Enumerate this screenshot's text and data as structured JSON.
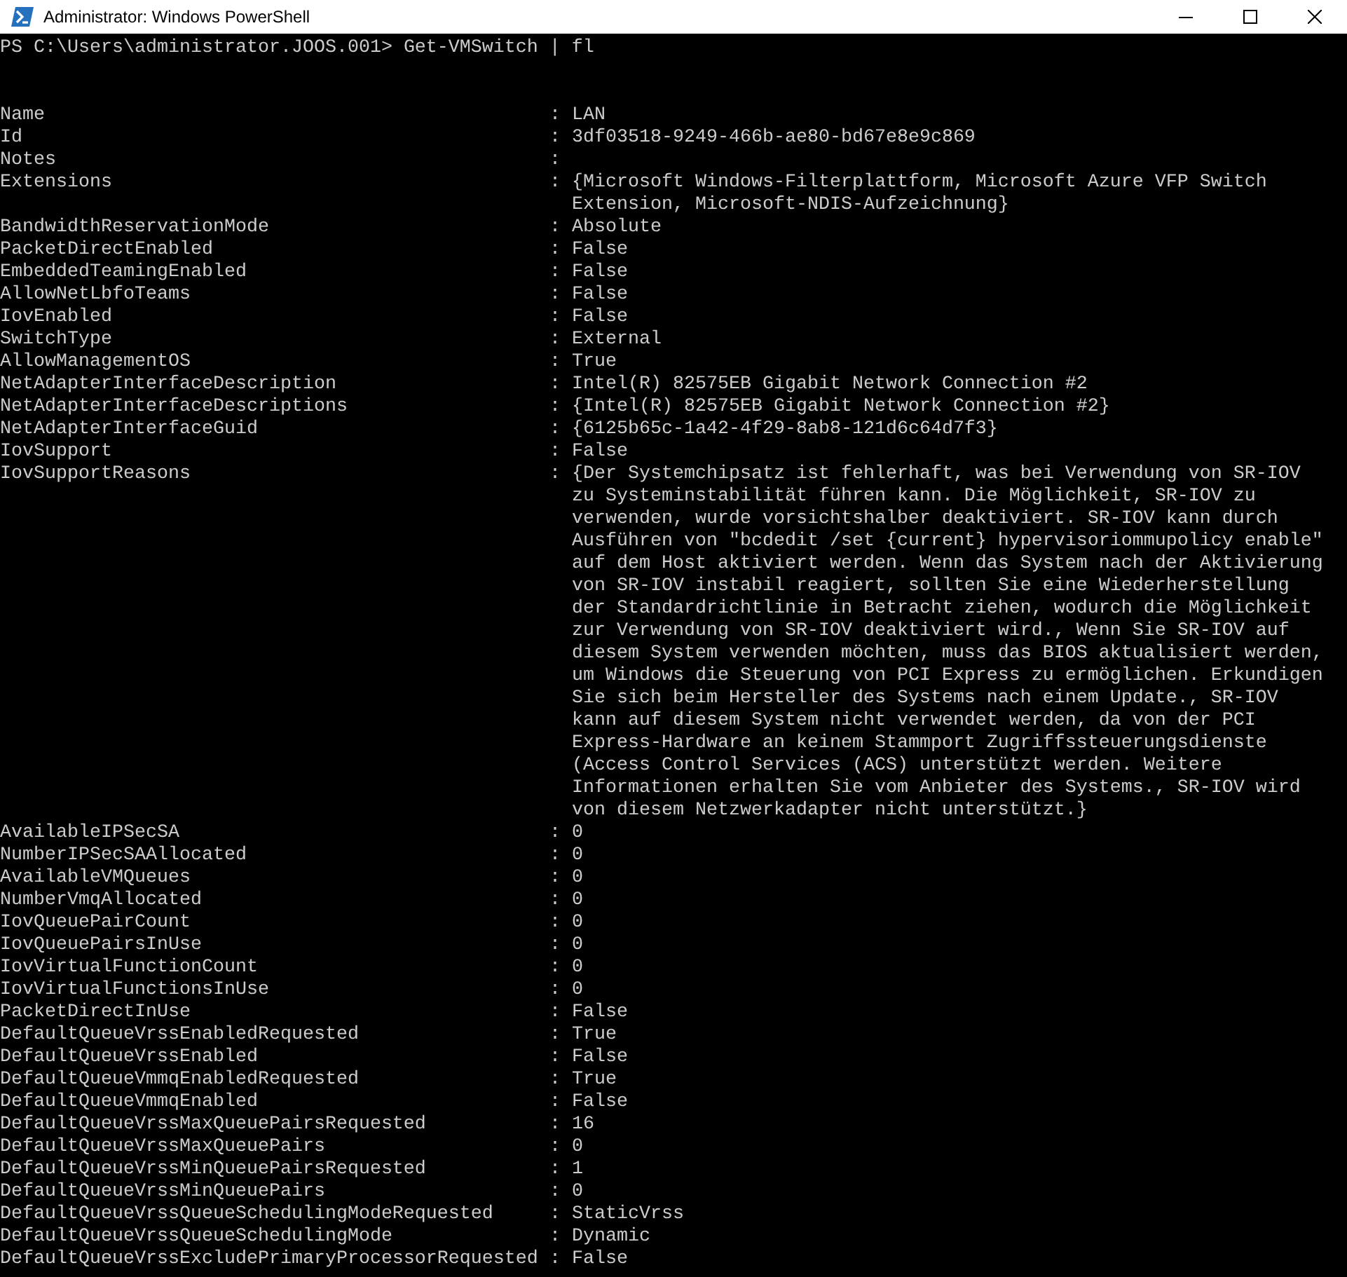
{
  "window": {
    "title": "Administrator: Windows PowerShell"
  },
  "console": {
    "prompt": "PS C:\\Users\\administrator.JOOS.001>",
    "command": "Get-VMSwitch | fl",
    "properties": [
      {
        "name": "Name",
        "sep": ":",
        "value": [
          "LAN"
        ]
      },
      {
        "name": "Id",
        "sep": ":",
        "value": [
          "3df03518-9249-466b-ae80-bd67e8e9c869"
        ]
      },
      {
        "name": "Notes",
        "sep": ":"
      },
      {
        "name": "Extensions",
        "sep": ":",
        "value": [
          "{Microsoft Windows-Filterplattform, Microsoft Azure VFP Switch",
          "Extension, Microsoft-NDIS-Aufzeichnung}"
        ]
      },
      {
        "name": "BandwidthReservationMode",
        "sep": ":",
        "value": [
          "Absolute"
        ]
      },
      {
        "name": "PacketDirectEnabled",
        "sep": ":",
        "value": [
          "False"
        ]
      },
      {
        "name": "EmbeddedTeamingEnabled",
        "sep": ":",
        "value": [
          "False"
        ]
      },
      {
        "name": "AllowNetLbfoTeams",
        "sep": ":",
        "value": [
          "False"
        ]
      },
      {
        "name": "IovEnabled",
        "sep": ":",
        "value": [
          "False"
        ]
      },
      {
        "name": "SwitchType",
        "sep": ":",
        "value": [
          "External"
        ]
      },
      {
        "name": "AllowManagementOS",
        "sep": ":",
        "value": [
          "True"
        ]
      },
      {
        "name": "NetAdapterInterfaceDescription",
        "sep": ":",
        "value": [
          "Intel(R) 82575EB Gigabit Network Connection #2"
        ]
      },
      {
        "name": "NetAdapterInterfaceDescriptions",
        "sep": ":",
        "value": [
          "{Intel(R) 82575EB Gigabit Network Connection #2}"
        ]
      },
      {
        "name": "NetAdapterInterfaceGuid",
        "sep": ":",
        "value": [
          "{6125b65c-1a42-4f29-8ab8-121d6c64d7f3}"
        ]
      },
      {
        "name": "IovSupport",
        "sep": ":",
        "value": [
          "False"
        ]
      },
      {
        "name": "IovSupportReasons",
        "sep": ":",
        "value": [
          "{Der Systemchipsatz ist fehlerhaft, was bei Verwendung von SR-IOV",
          "zu Systeminstabilität führen kann. Die Möglichkeit, SR-IOV zu",
          "verwenden, wurde vorsichtshalber deaktiviert. SR-IOV kann durch",
          "Ausführen von \"bcdedit /set {current} hypervisoriommupolicy enable\"",
          "auf dem Host aktiviert werden. Wenn das System nach der Aktivierung",
          "von SR-IOV instabil reagiert, sollten Sie eine Wiederherstellung",
          "der Standardrichtlinie in Betracht ziehen, wodurch die Möglichkeit",
          "zur Verwendung von SR-IOV deaktiviert wird., Wenn Sie SR-IOV auf",
          "diesem System verwenden möchten, muss das BIOS aktualisiert werden,",
          "um Windows die Steuerung von PCI Express zu ermöglichen. Erkundigen",
          "Sie sich beim Hersteller des Systems nach einem Update., SR-IOV",
          "kann auf diesem System nicht verwendet werden, da von der PCI",
          "Express-Hardware an keinem Stammport Zugriffssteuerungsdienste",
          "(Access Control Services (ACS) unterstützt werden. Weitere",
          "Informationen erhalten Sie vom Anbieter des Systems., SR-IOV wird",
          "von diesem Netzwerkadapter nicht unterstützt.}"
        ]
      },
      {
        "name": "AvailableIPSecSA",
        "sep": ":",
        "value": [
          "0"
        ]
      },
      {
        "name": "NumberIPSecSAAllocated",
        "sep": ":",
        "value": [
          "0"
        ]
      },
      {
        "name": "AvailableVMQueues",
        "sep": ":",
        "value": [
          "0"
        ]
      },
      {
        "name": "NumberVmqAllocated",
        "sep": ":",
        "value": [
          "0"
        ]
      },
      {
        "name": "IovQueuePairCount",
        "sep": ":",
        "value": [
          "0"
        ]
      },
      {
        "name": "IovQueuePairsInUse",
        "sep": ":",
        "value": [
          "0"
        ]
      },
      {
        "name": "IovVirtualFunctionCount",
        "sep": ":",
        "value": [
          "0"
        ]
      },
      {
        "name": "IovVirtualFunctionsInUse",
        "sep": ":",
        "value": [
          "0"
        ]
      },
      {
        "name": "PacketDirectInUse",
        "sep": ":",
        "value": [
          "False"
        ]
      },
      {
        "name": "DefaultQueueVrssEnabledRequested",
        "sep": ":",
        "value": [
          "True"
        ]
      },
      {
        "name": "DefaultQueueVrssEnabled",
        "sep": ":",
        "value": [
          "False"
        ]
      },
      {
        "name": "DefaultQueueVmmqEnabledRequested",
        "sep": ":",
        "value": [
          "True"
        ]
      },
      {
        "name": "DefaultQueueVmmqEnabled",
        "sep": ":",
        "value": [
          "False"
        ]
      },
      {
        "name": "DefaultQueueVrssMaxQueuePairsRequested",
        "sep": ":",
        "value": [
          "16"
        ]
      },
      {
        "name": "DefaultQueueVrssMaxQueuePairs",
        "sep": ":",
        "value": [
          "0"
        ]
      },
      {
        "name": "DefaultQueueVrssMinQueuePairsRequested",
        "sep": ":",
        "value": [
          "1"
        ]
      },
      {
        "name": "DefaultQueueVrssMinQueuePairs",
        "sep": ":",
        "value": [
          "0"
        ]
      },
      {
        "name": "DefaultQueueVrssQueueSchedulingModeRequested",
        "sep": ":",
        "value": [
          "StaticVrss"
        ]
      },
      {
        "name": "DefaultQueueVrssQueueSchedulingMode",
        "sep": ":",
        "value": [
          "Dynamic"
        ]
      },
      {
        "name": "DefaultQueueVrssExcludePrimaryProcessorRequested",
        "sep": ":",
        "value": [
          "False"
        ]
      }
    ]
  }
}
